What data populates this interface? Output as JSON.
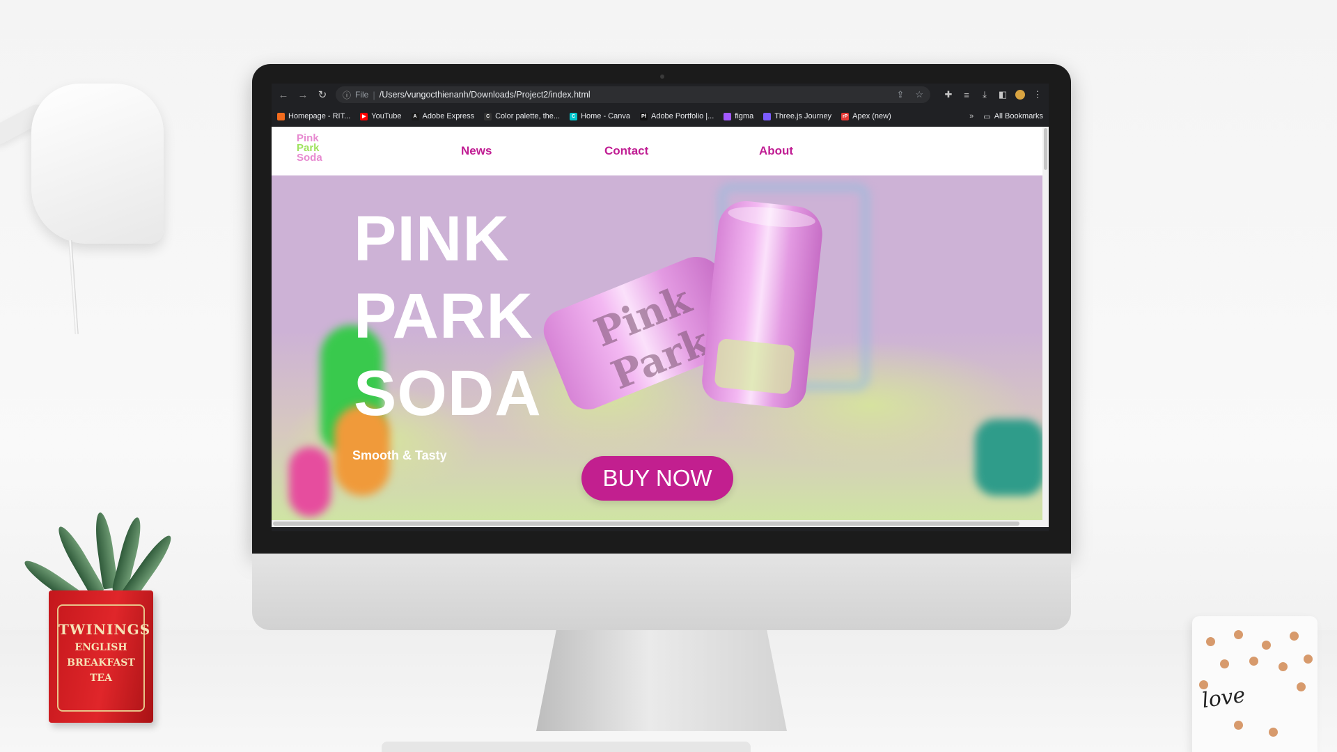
{
  "browser": {
    "scheme": "File",
    "url": "/Users/vungocthienanh/Downloads/Project2/index.html",
    "bookmarks": [
      {
        "label": "Homepage - RIT...",
        "color": "#f26b1d",
        "glyph": ""
      },
      {
        "label": "YouTube",
        "color": "#ff0000",
        "glyph": "▶"
      },
      {
        "label": "Adobe Express",
        "color": "#1a1a1a",
        "glyph": "A"
      },
      {
        "label": "Color palette, the...",
        "color": "#333333",
        "glyph": "C"
      },
      {
        "label": "Home - Canva",
        "color": "#00c4cc",
        "glyph": "C"
      },
      {
        "label": "Adobe Portfolio |...",
        "color": "#111111",
        "glyph": "Pf"
      },
      {
        "label": "figma",
        "color": "#a259ff",
        "glyph": ""
      },
      {
        "label": "Three.js Journey",
        "color": "#7c5cff",
        "glyph": ""
      },
      {
        "label": "Apex (new)",
        "color": "#e53935",
        "glyph": "rP"
      }
    ],
    "more": "»",
    "all_bookmarks": "All Bookmarks"
  },
  "site": {
    "logo": [
      "Pink",
      "Park",
      "Soda"
    ],
    "nav": [
      "News",
      "Contact",
      "About"
    ],
    "hero": {
      "title_lines": [
        "PINK",
        "PARK",
        "SODA"
      ],
      "subtitle": "Smooth & Tasty",
      "cta": "BUY NOW"
    },
    "can_text": "Pink Park"
  },
  "scene": {
    "pot_brand": "TWININGS",
    "pot_sub": [
      "ENGLISH",
      "BREAKFAST",
      "TEA"
    ],
    "mug_text": "love"
  },
  "colors": {
    "accent": "#c21f8f",
    "hero_bg": "#cdb2d6",
    "nav_link": "#c01d93"
  }
}
